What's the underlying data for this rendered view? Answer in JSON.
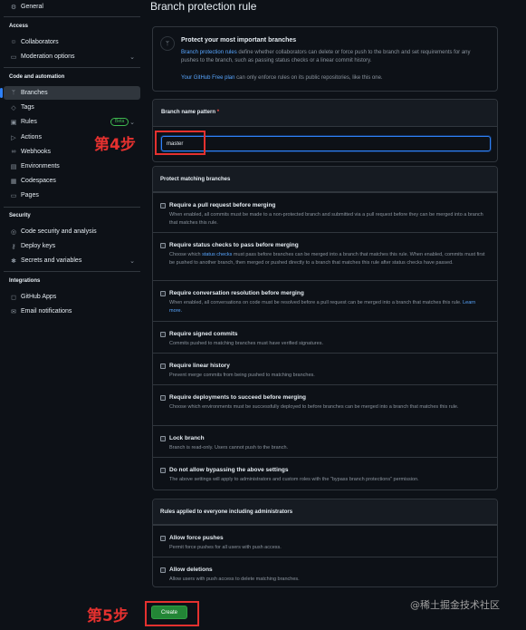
{
  "sidebar": {
    "general": {
      "label": "General",
      "icon": "gear-icon"
    },
    "access_title": "Access",
    "access": [
      {
        "label": "Collaborators",
        "icon": "people-icon"
      },
      {
        "label": "Moderation options",
        "icon": "report-icon"
      }
    ],
    "code_title": "Code and automation",
    "code": [
      {
        "label": "Branches",
        "icon": "git-branch-icon"
      },
      {
        "label": "Tags",
        "icon": "tag-icon"
      },
      {
        "label": "Rules",
        "icon": "rules-icon",
        "badge": "Beta"
      },
      {
        "label": "Actions",
        "icon": "play-icon"
      },
      {
        "label": "Webhooks",
        "icon": "webhook-icon"
      },
      {
        "label": "Environments",
        "icon": "server-icon"
      },
      {
        "label": "Codespaces",
        "icon": "codespaces-icon"
      },
      {
        "label": "Pages",
        "icon": "browser-icon"
      }
    ],
    "security_title": "Security",
    "security": [
      {
        "label": "Code security and analysis",
        "icon": "codescan-icon"
      },
      {
        "label": "Deploy keys",
        "icon": "key-icon"
      },
      {
        "label": "Secrets and variables",
        "icon": "key-asterisk-icon"
      }
    ],
    "integrations_title": "Integrations",
    "integrations": [
      {
        "label": "GitHub Apps",
        "icon": "apps-icon"
      },
      {
        "label": "Email notifications",
        "icon": "mail-icon"
      }
    ]
  },
  "main": {
    "title": "Branch protection rule",
    "info": {
      "title": "Protect your most important branches",
      "link": "Branch protection rules",
      "desc": " define whether collaborators can delete or force push to the branch and set requirements for any pushes to the branch, such as passing status checks or a linear commit history.",
      "plan_link": "Your GitHub Free plan",
      "plan_text": " can only enforce rules on its public repositories, like this one."
    },
    "pattern": {
      "label": "Branch name pattern",
      "required": "*",
      "value": "master"
    },
    "protect": {
      "header": "Protect matching branches",
      "rules": [
        {
          "title": "Require a pull request before merging",
          "desc": "When enabled, all commits must be made to a non-protected branch and submitted via a pull request before they can be merged into a branch that matches this rule."
        },
        {
          "title": "Require status checks to pass before merging",
          "desc_pre": "Choose which ",
          "desc_link": "status checks",
          "desc": " must pass before branches can be merged into a branch that matches this rule. When enabled, commits must first be pushed to another branch, then merged or pushed directly to a branch that matches this rule after status checks have passed."
        },
        {
          "title": "Require conversation resolution before merging",
          "desc": "When enabled, all conversations on code must be resolved before a pull request can be merged into a branch that matches this rule. ",
          "desc_link": "Learn more."
        },
        {
          "title": "Require signed commits",
          "desc": "Commits pushed to matching branches must have verified signatures."
        },
        {
          "title": "Require linear history",
          "desc": "Prevent merge commits from being pushed to matching branches."
        },
        {
          "title": "Require deployments to succeed before merging",
          "desc": "Choose which environments must be successfully deployed to before branches can be merged into a branch that matches this rule."
        },
        {
          "title": "Lock branch",
          "desc": "Branch is read-only. Users cannot push to the branch."
        },
        {
          "title": "Do not allow bypassing the above settings",
          "desc": "The above settings will apply to administrators and custom roles with the \"bypass branch protections\" permission."
        }
      ]
    },
    "admin": {
      "header": "Rules applied to everyone including administrators",
      "rules": [
        {
          "title": "Allow force pushes",
          "desc": "Permit force pushes for all users with push access."
        },
        {
          "title": "Allow deletions",
          "desc": "Allow users with push access to delete matching branches."
        }
      ]
    },
    "create_label": "Create"
  },
  "annotations": {
    "step4": "第4步",
    "step5": "第5步",
    "color": "#e5312f"
  },
  "watermark": "@稀土掘金技术社区"
}
